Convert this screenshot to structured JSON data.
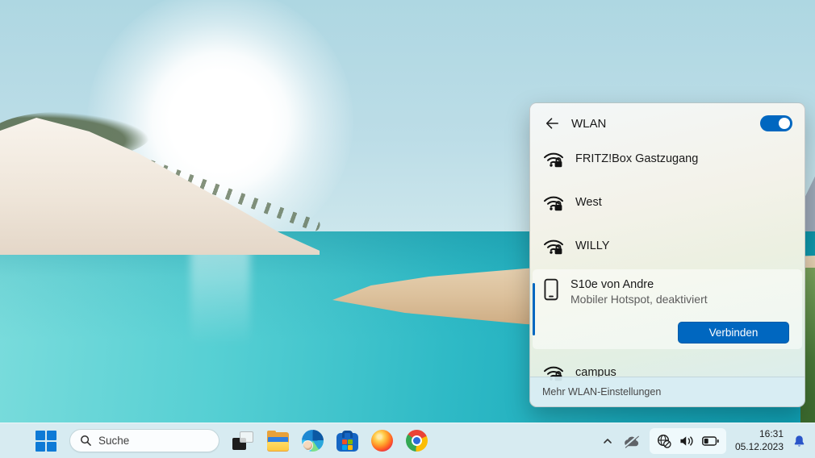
{
  "colors": {
    "accent": "#0067c0",
    "taskbar_bg": "#d7ebf1",
    "bell_blue": "#2a55c9"
  },
  "wlan_panel": {
    "title": "WLAN",
    "toggle_state": "on",
    "networks": [
      {
        "name": "FRITZ!Box Gastzugang",
        "secured": true
      },
      {
        "name": "West",
        "secured": true
      },
      {
        "name": "WILLY",
        "secured": true
      }
    ],
    "device": {
      "name": "S10e von Andre",
      "status": "Mobiler Hotspot, deaktiviert",
      "action": "Verbinden"
    },
    "partial_network": {
      "name": "campus",
      "secured": true
    },
    "footer_link": "Mehr WLAN-Einstellungen"
  },
  "taskbar": {
    "search_placeholder": "Suche",
    "apps": [
      "overlapping-windows",
      "file-explorer",
      "edge",
      "microsoft-store",
      "firefox",
      "chrome"
    ],
    "tray_icons": [
      "chevron-up",
      "onedrive-offline",
      "globe-no-internet",
      "volume",
      "battery"
    ],
    "clock": {
      "time": "16:31",
      "date": "05.12.2023"
    }
  }
}
